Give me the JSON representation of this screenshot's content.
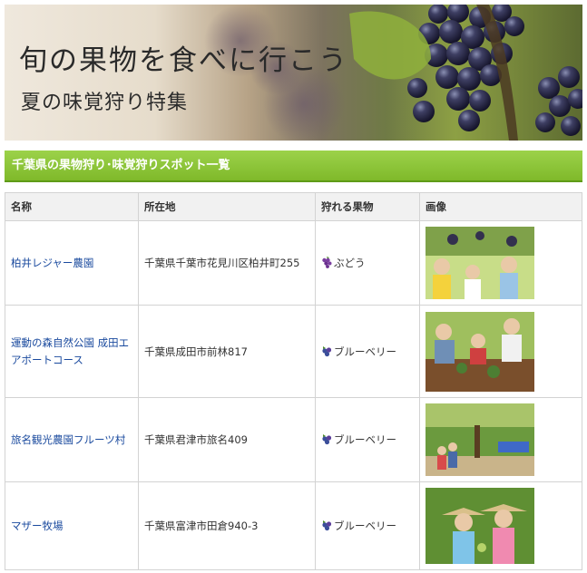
{
  "hero": {
    "title": "旬の果物を食べに行こう",
    "subtitle": "夏の味覚狩り特集"
  },
  "section": {
    "heading": "千葉県の果物狩り･味覚狩りスポット一覧"
  },
  "table": {
    "headers": {
      "name": "名称",
      "location": "所在地",
      "fruit": "狩れる果物",
      "image": "画像"
    },
    "rows": [
      {
        "name": "柏井レジャー農園",
        "location": "千葉県千葉市花見川区柏井町255",
        "fruit": "ぶどう",
        "fruit_icon": "grape-icon"
      },
      {
        "name": "運動の森自然公園 成田エアポートコース",
        "location": "千葉県成田市前林817",
        "fruit": "ブルーベリー",
        "fruit_icon": "blueberry-icon"
      },
      {
        "name": "旅名観光農園フルーツ村",
        "location": "千葉県君津市旅名409",
        "fruit": "ブルーベリー",
        "fruit_icon": "blueberry-icon"
      },
      {
        "name": "マザー牧場",
        "location": "千葉県富津市田倉940-3",
        "fruit": "ブルーベリー",
        "fruit_icon": "blueberry-icon"
      }
    ]
  },
  "colors": {
    "section_bar": "#8cc63f",
    "link": "#1a4a9e",
    "header_bg": "#f1f1f1"
  }
}
